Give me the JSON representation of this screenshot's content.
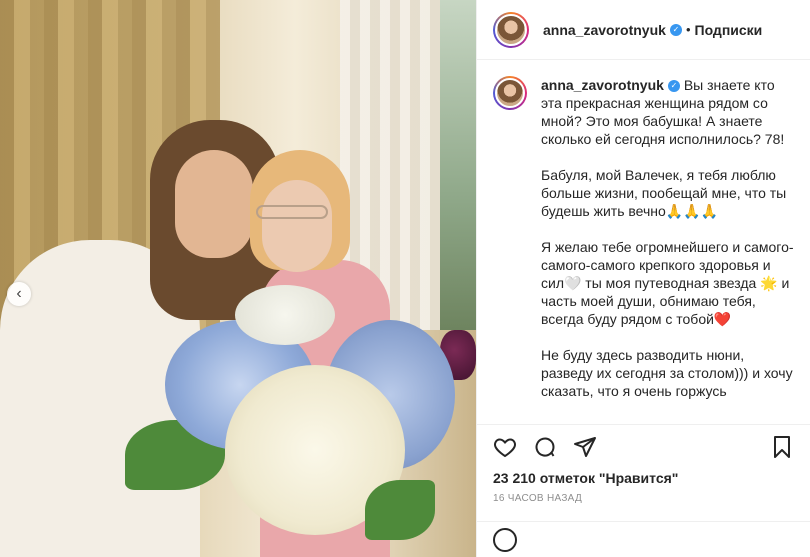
{
  "post": {
    "username": "anna_zavorotnyuk",
    "follow_label": "Подписки",
    "separator": "•",
    "caption_paragraphs": [
      "Вы знаете кто эта прекрасная женщина рядом со мной? Это моя бабушка! А знаете сколько ей сегодня исполнилось? 78!",
      "Бабуля, мой Валечек, я тебя люблю больше жизни, пообещай мне, что ты будешь жить вечно🙏🙏🙏",
      "Я желаю тебе огромнейшего и самого-самого-самого крепкого здоровья и сил🤍 ты моя путеводная звезда 🌟 и часть моей души, обнимаю тебя, всегда буду рядом с тобой❤️",
      "Не буду здесь разводить нюни, разведу их сегодня за столом))) и хочу сказать, что я очень горжусь"
    ],
    "likes": "23 210 отметок \"Нравится\"",
    "time": "16 часов назад"
  },
  "icons": {
    "like": "heart-outline-icon",
    "comment": "speech-bubble-icon",
    "share": "paper-plane-icon",
    "save": "bookmark-icon",
    "carousel_prev": "chevron-left-icon",
    "verified": "verified-badge-icon"
  },
  "colors": {
    "verified": "#3897f0",
    "text": "#262626",
    "muted": "#8e8e8e",
    "border": "#efefef"
  }
}
